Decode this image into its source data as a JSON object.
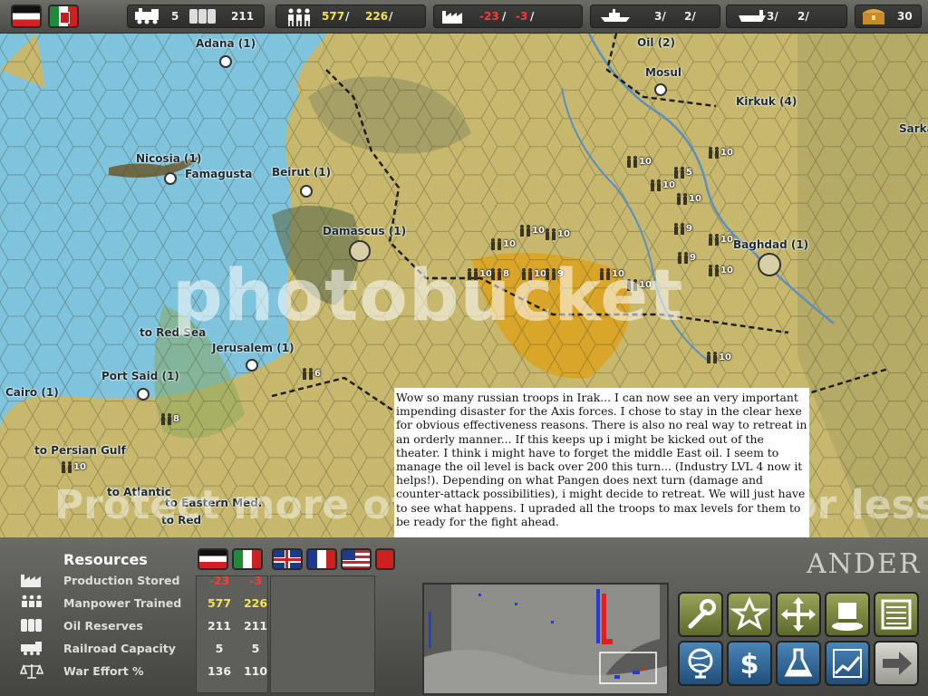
{
  "topbar": {
    "railroad": "5",
    "oil": "211",
    "manpower_a": "577",
    "manpower_b": "226",
    "production_a": "-23",
    "production_b": "-3",
    "production_sep": "/",
    "naval_a": "3/",
    "naval_b": "2/",
    "transport_a": "3/",
    "transport_b": "2/",
    "mpp": "30",
    "sep": "/"
  },
  "map": {
    "cities": [
      {
        "label": "Adana (1)"
      },
      {
        "label": "Oil (2)"
      },
      {
        "label": "Mosul"
      },
      {
        "label": "Kirkuk (4)"
      },
      {
        "label": "Sarka"
      },
      {
        "label": "Nicosia (1)"
      },
      {
        "label": "Famagusta"
      },
      {
        "label": "Beirut (1)"
      },
      {
        "label": "Damascus (1)"
      },
      {
        "label": "Baghdad (1)"
      },
      {
        "label": "to Red Sea"
      },
      {
        "label": "Jerusalem (1)"
      },
      {
        "label": "Port Said (1)"
      },
      {
        "label": "Cairo (1)"
      },
      {
        "label": "to Persian Gulf"
      },
      {
        "label": "to Eastern Med."
      },
      {
        "label": "to Atlantic"
      },
      {
        "label": "to Red"
      }
    ],
    "unit_strengths": [
      "10",
      "10",
      "5",
      "10",
      "10",
      "10",
      "10",
      "9",
      "10",
      "10",
      "10",
      "10",
      "9",
      "10",
      "8",
      "9",
      "10",
      "10",
      "10",
      "6",
      "8",
      "10"
    ],
    "watermark": "photobucket",
    "watermark2": "Protect more of your memories for less!"
  },
  "comment": "Wow so many russian troops in Irak... I can now see an very important impending disaster for the Axis forces. I chose to stay in the clear hexe for obvious effectiveness reasons. There is also no real way to retreat in an orderly manner... If this keeps up i might be kicked out of the theater. I think i might have to forget the middle East oil. I seem to manage the oil level is back over 200 this turn... (Industry LVL 4 now it helps!). Depending on what Pangen does next turn (damage and counter-attack possibilities), i might decide to retreat. We will just have to see what happens. I upraded all the troops to max levels for them to be ready for the fight ahead.",
  "resources": {
    "title": "Resources",
    "rows": [
      {
        "label": "Production Stored",
        "v1": "-23",
        "v2": "-3",
        "icon": "factory-icon"
      },
      {
        "label": "Manpower Trained",
        "v1": "577",
        "v2": "226",
        "icon": "manpower-icon"
      },
      {
        "label": "Oil Reserves",
        "v1": "211",
        "v2": "211",
        "icon": "oil-barrels-icon"
      },
      {
        "label": "Railroad Capacity",
        "v1": "5",
        "v2": "5",
        "icon": "locomotive-icon"
      },
      {
        "label": "War Effort %",
        "v1": "136",
        "v2": "110",
        "icon": "scales-icon"
      }
    ]
  },
  "commander_text": "ANDER",
  "colors": {
    "sea": "#7fc3dd",
    "land": "#c9b86a",
    "desert": "#d9a62a",
    "negative": "#ff3a3a",
    "positive": "#f2e25a"
  }
}
